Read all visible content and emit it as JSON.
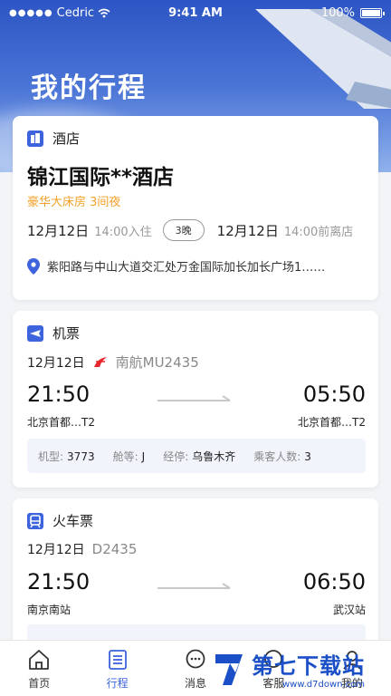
{
  "status": {
    "carrier": "Cedric",
    "time": "9:41 AM",
    "battery": "100%"
  },
  "page_title": "我的行程",
  "hotel": {
    "category": "酒店",
    "name": "锦江国际**酒店",
    "room": "豪华大床房  3间夜",
    "checkin_date": "12月12日",
    "checkin_time": "14:00入住",
    "nights": "3晚",
    "checkout_date": "12月12日",
    "checkout_time": "14:00前离店",
    "address": "紫阳路与中山大道交汇处万金国际加长加长广场1……"
  },
  "flight": {
    "category": "机票",
    "date": "12月12日",
    "carrier": "南航MU2435",
    "dep_time": "21:50",
    "arr_time": "05:50",
    "dep_station": "北京首都…T2",
    "arr_station": "北京首都…T2",
    "info": {
      "model_label": "机型:",
      "model": "3773",
      "cabin_label": "舱等:",
      "cabin": "J",
      "stop_label": "经停:",
      "stop": "乌鲁木齐",
      "pax_label": "乘客人数:",
      "pax": "3"
    }
  },
  "train": {
    "category": "火车票",
    "date": "12月12日",
    "number": "D2435",
    "dep_time": "21:50",
    "arr_time": "06:50",
    "dep_station": "南京南站",
    "arr_station": "武汉站"
  },
  "tabs": [
    {
      "label": "首页",
      "icon": "home-icon"
    },
    {
      "label": "行程",
      "icon": "itinerary-icon"
    },
    {
      "label": "消息",
      "icon": "message-icon"
    },
    {
      "label": "客服",
      "icon": "service-icon"
    },
    {
      "label": "我的",
      "icon": "profile-icon"
    }
  ],
  "watermark": {
    "text": "第七下载站",
    "url": "www.d7down.com"
  },
  "colors": {
    "accent": "#3d63dd",
    "room_text": "#f2a128",
    "airline_red": "#e8262d"
  }
}
